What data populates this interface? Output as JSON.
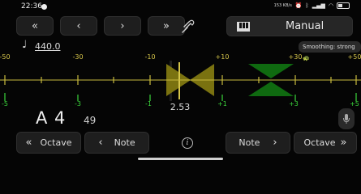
{
  "status_bar": {
    "time": "22:36",
    "net_speed": "153 KB/s",
    "battery": "42"
  },
  "toolbar": {
    "nav_buttons": [
      "«",
      "‹",
      "›",
      "»"
    ],
    "mode_label": "Manual"
  },
  "reference": {
    "frequency": "440.0"
  },
  "smoothing": {
    "label": "Smoothing: strong"
  },
  "scale": {
    "cents_labels": [
      "-50",
      "-30",
      "-10",
      "+10",
      "+30",
      "+50"
    ],
    "semitone_labels": [
      "-5",
      "-3",
      "-1",
      "+1",
      "+3",
      "+5"
    ]
  },
  "reading": {
    "deviation": "2.53",
    "note": "A 4",
    "note_number": "49"
  },
  "bottom_bar": {
    "octave_down": "Octave",
    "note_down": "Note",
    "note_up": "Note",
    "octave_up": "Octave"
  },
  "colors": {
    "cents_scale": "#d6c64a",
    "semitone_scale": "#3bd43b",
    "marker_yellow": "#7a7210",
    "marker_green": "#0f6a10"
  }
}
